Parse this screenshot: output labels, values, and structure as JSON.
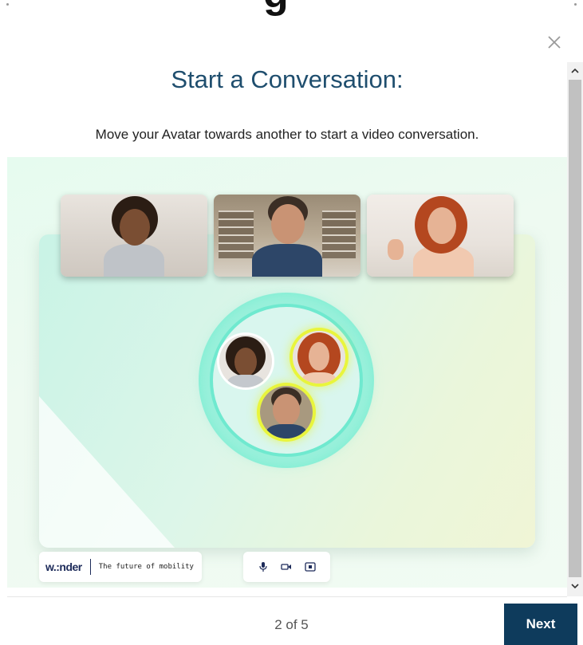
{
  "background_title_fragment": "g",
  "modal": {
    "title": "Start a Conversation:",
    "subtitle": "Move your Avatar towards another to start a video conversation."
  },
  "illustration": {
    "brand": {
      "logo_text": "w.:nder",
      "tagline": "The future of mobility"
    },
    "video_tiles": [
      {
        "name": "woman-curly-hair-video-tile"
      },
      {
        "name": "man-glasses-video-tile"
      },
      {
        "name": "woman-red-hair-video-tile"
      }
    ],
    "controls": [
      "microphone-icon",
      "camera-icon",
      "screen-share-icon"
    ]
  },
  "footer": {
    "pager": "2 of 5",
    "next_label": "Next"
  },
  "icons": {
    "close": "close-icon",
    "scroll_up": "chevron-up-icon",
    "scroll_down": "chevron-down-icon"
  },
  "colors": {
    "title": "#1f4e6e",
    "next_button": "#0e3b5c",
    "bubble_ring": "#6fe9cf",
    "avatar_highlight": "#e9f53c"
  }
}
